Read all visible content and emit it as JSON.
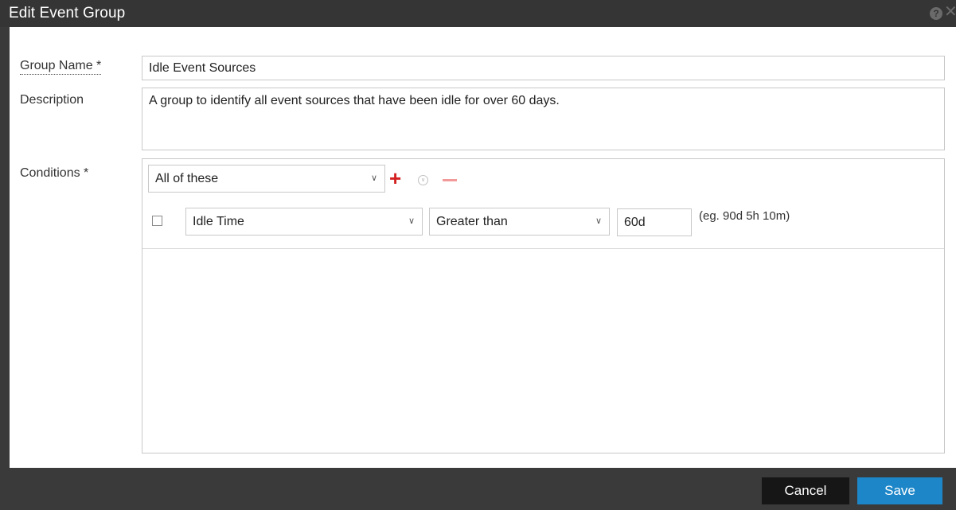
{
  "dialog": {
    "title": "Edit Event Group",
    "help_icon": "help-icon",
    "close_icon": "close-icon"
  },
  "form": {
    "group_name": {
      "label": "Group Name *",
      "value": "Idle Event Sources"
    },
    "description": {
      "label": "Description",
      "value": "A group to identify all event sources that have been idle for over 60 days."
    },
    "conditions": {
      "label": "Conditions *",
      "match_mode": "All of these",
      "add_icon": "plus-icon",
      "expand_icon": "circle-chevron-down-icon",
      "remove_icon": "minus-icon",
      "rows": [
        {
          "checked": false,
          "field": "Idle Time",
          "operator": "Greater than",
          "value": "60d",
          "hint": "(eg. 90d 5h 10m)"
        }
      ]
    }
  },
  "footer": {
    "cancel_label": "Cancel",
    "save_label": "Save"
  },
  "colors": {
    "title_bar": "#353535",
    "save_button": "#1d86c8",
    "cancel_button": "#161616",
    "add_icon": "#d32020",
    "remove_icon": "#f29a9a"
  }
}
